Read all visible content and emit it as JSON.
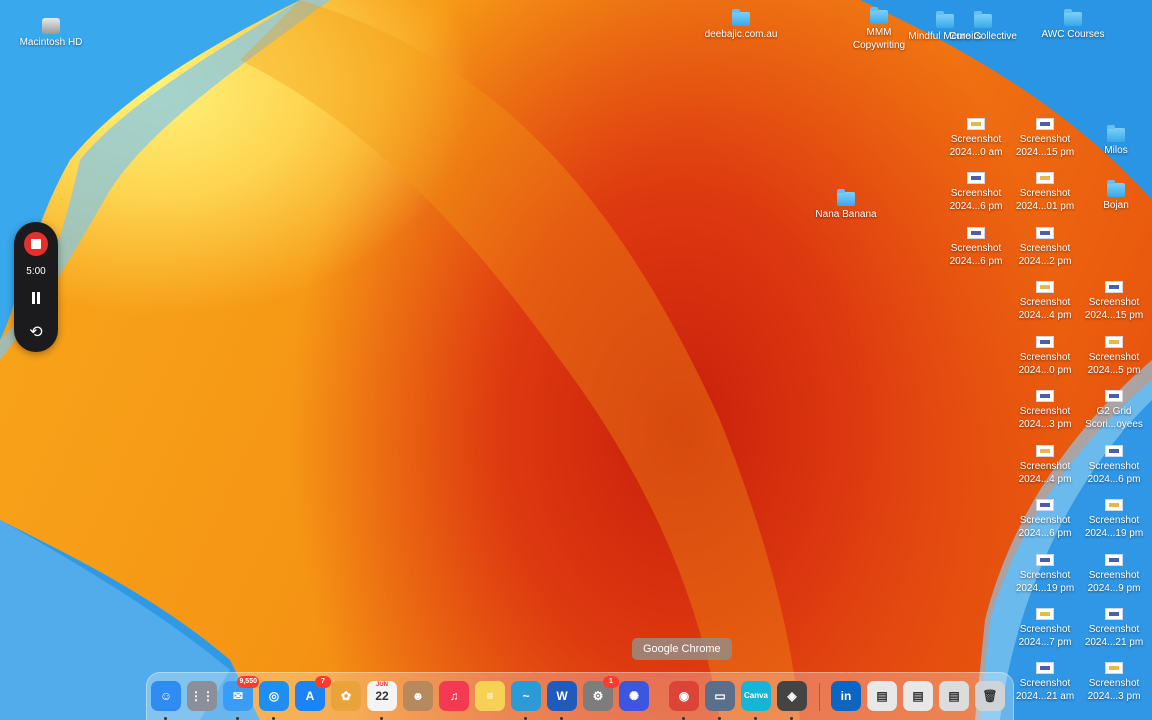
{
  "desktop_items": [
    {
      "id": "macintosh-hd",
      "kind": "disk",
      "label": "Macintosh HD"
    },
    {
      "id": "deebajic",
      "kind": "folder",
      "label": "deebajic.com.au"
    },
    {
      "id": "mmm",
      "kind": "folder",
      "label": "MMM Copywriting"
    },
    {
      "id": "mindful",
      "kind": "folder",
      "label": "Mindful Memoirs"
    },
    {
      "id": "cure",
      "kind": "folder",
      "label": "Cure Collective"
    },
    {
      "id": "awc",
      "kind": "folder",
      "label": "AWC Courses"
    },
    {
      "id": "nana",
      "kind": "folder",
      "label": "Nana Banana"
    },
    {
      "id": "milos",
      "kind": "folder",
      "label": "Milos"
    },
    {
      "id": "bojan",
      "kind": "folder",
      "label": "Bojan"
    },
    {
      "id": "s1",
      "kind": "screenshot",
      "label": "Screenshot 2024...0 am"
    },
    {
      "id": "s2",
      "kind": "screenshot",
      "label": "Screenshot 2024...15 pm"
    },
    {
      "id": "s3",
      "kind": "screenshot",
      "label": "Screenshot 2024...6 pm"
    },
    {
      "id": "s4",
      "kind": "screenshot",
      "label": "Screenshot 2024...01 pm"
    },
    {
      "id": "s5",
      "kind": "screenshot",
      "label": "Screenshot 2024...6 pm"
    },
    {
      "id": "s6",
      "kind": "screenshot",
      "label": "Screenshot 2024...2 pm"
    },
    {
      "id": "s7",
      "kind": "screenshot",
      "label": "Screenshot 2024...4 pm"
    },
    {
      "id": "s8",
      "kind": "screenshot",
      "label": "Screenshot 2024...15 pm"
    },
    {
      "id": "s9",
      "kind": "screenshot",
      "label": "Screenshot 2024...0 pm"
    },
    {
      "id": "s10",
      "kind": "screenshot",
      "label": "Screenshot 2024...5 pm"
    },
    {
      "id": "s11",
      "kind": "screenshot",
      "label": "Screenshot 2024...3 pm"
    },
    {
      "id": "g2",
      "kind": "file",
      "label": "G2 Grid Scori...oyees"
    },
    {
      "id": "s12",
      "kind": "screenshot",
      "label": "Screenshot 2024...4 pm"
    },
    {
      "id": "s13",
      "kind": "screenshot",
      "label": "Screenshot 2024...6 pm"
    },
    {
      "id": "s14",
      "kind": "screenshot",
      "label": "Screenshot 2024...6 pm"
    },
    {
      "id": "s15",
      "kind": "screenshot",
      "label": "Screenshot 2024...19 pm"
    },
    {
      "id": "s16",
      "kind": "screenshot",
      "label": "Screenshot 2024...19 pm"
    },
    {
      "id": "s17",
      "kind": "screenshot",
      "label": "Screenshot 2024...9 pm"
    },
    {
      "id": "s18",
      "kind": "screenshot",
      "label": "Screenshot 2024...7 pm"
    },
    {
      "id": "s19",
      "kind": "screenshot",
      "label": "Screenshot 2024...21 pm"
    },
    {
      "id": "s20",
      "kind": "screenshot",
      "label": "Screenshot 2024...21 am"
    },
    {
      "id": "s21",
      "kind": "screenshot",
      "label": "Screenshot 2024...3 pm"
    }
  ],
  "recorder": {
    "time": "5:00",
    "record_icon": "stop-record-icon",
    "pause_icon": "pause-icon",
    "restart_icon": "restart-icon",
    "restart_glyph": "⟲"
  },
  "tooltip": {
    "text": "Google Chrome"
  },
  "dock": {
    "items": [
      {
        "name": "finder",
        "glyph": "☺",
        "color": "#2f8cf0",
        "running": true
      },
      {
        "name": "launchpad",
        "glyph": "⋮⋮",
        "color": "#8a8f99",
        "running": false
      },
      {
        "name": "mail",
        "glyph": "✉",
        "color": "#3a9cf3",
        "badge": "9,550",
        "running": true
      },
      {
        "name": "safari",
        "glyph": "◎",
        "color": "#1f8ef1",
        "running": true
      },
      {
        "name": "app-store",
        "glyph": "A",
        "color": "#1c83f5",
        "badge": "7",
        "running": false
      },
      {
        "name": "photos",
        "glyph": "✿",
        "color": "#e8a43b",
        "running": false
      },
      {
        "name": "calendar",
        "glyph": "22",
        "color": "#f4f4f4",
        "month": "JUN",
        "running": true
      },
      {
        "name": "contacts",
        "glyph": "☻",
        "color": "#b68a5c",
        "running": false
      },
      {
        "name": "music",
        "glyph": "♫",
        "color": "#f43a52",
        "running": false
      },
      {
        "name": "notes",
        "glyph": "≡",
        "color": "#f7d155",
        "running": false
      },
      {
        "name": "freeform",
        "glyph": "~",
        "color": "#2a9bd6",
        "running": true
      },
      {
        "name": "word",
        "glyph": "W",
        "color": "#1e5bbd",
        "running": true
      },
      {
        "name": "system-settings",
        "glyph": "⚙",
        "color": "#7d7d7d",
        "badge": "1",
        "running": false
      },
      {
        "name": "perplexity",
        "glyph": "✺",
        "color": "#3d56e0",
        "running": false
      },
      {
        "name": "chrome",
        "glyph": "◉",
        "color": "#db4437",
        "running": true
      },
      {
        "name": "preview",
        "glyph": "▭",
        "color": "#5b6f8a",
        "running": true
      },
      {
        "name": "canva",
        "glyph": "Canva",
        "color": "#13b6d6",
        "running": true
      },
      {
        "name": "chatgpt",
        "glyph": "◈",
        "color": "#444444",
        "running": true
      },
      {
        "name": "linkedin",
        "glyph": "in",
        "color": "#0a66c2",
        "running": false
      },
      {
        "name": "recent-doc-1",
        "glyph": "▤",
        "color": "#e8e8e8",
        "running": false
      },
      {
        "name": "recent-doc-2",
        "glyph": "▤",
        "color": "#e8e8e8",
        "running": false
      },
      {
        "name": "recent-doc-3",
        "glyph": "▤",
        "color": "#dcdcdc",
        "running": false
      },
      {
        "name": "trash",
        "glyph": "🗑",
        "color": "#cfd3d8",
        "running": false
      }
    ]
  }
}
